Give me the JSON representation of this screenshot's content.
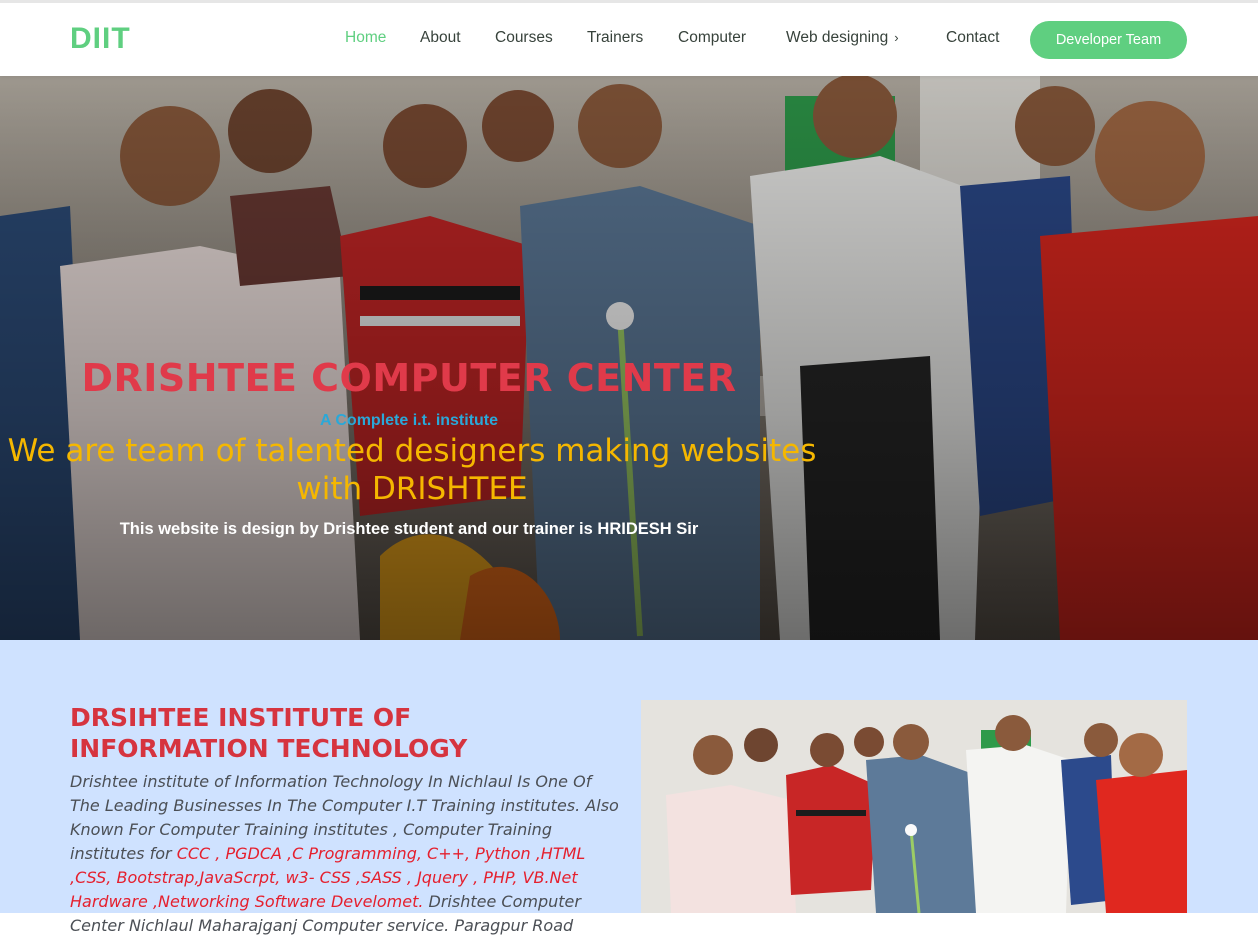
{
  "header": {
    "logo": "DIIT",
    "nav": [
      {
        "label": "Home",
        "active": true
      },
      {
        "label": "About"
      },
      {
        "label": "Courses"
      },
      {
        "label": "Trainers"
      },
      {
        "label": "Computer"
      },
      {
        "label": "Web designing",
        "has_submenu": true
      },
      {
        "label": "Contact"
      }
    ],
    "cta": "Developer Team"
  },
  "hero": {
    "title": "DRISHTEE COMPUTER CENTER",
    "subtitle": "A Complete i.t. institute",
    "tagline": "We are team of talented designers making websites with DRISHTEE",
    "credit": "This website is design by Drishtee student and our trainer is HRIDESH Sir"
  },
  "about": {
    "title": "DRSIHTEE INSTITUTE OF INFORMATION TECHNOLOGY",
    "text_plain": "Drishtee institute of Information Technology In Nichlaul Is One Of The Leading Businesses In The Computer I.T Training institutes. Also Known For Computer Training institutes , Computer Training institutes for ",
    "text_highlight": "CCC , PGDCA ,C Programming, C++, Python ,HTML ,CSS, Bootstrap,JavaScrpt, w3- CSS ,SASS , Jquery , PHP, VB.Net Hardware ,Networking Software Develomet.",
    "text_tail": " Drishtee Computer Center Nichlaul Maharajganj Computer service. Paragpur Road"
  },
  "colors": {
    "brand_green": "#5fcf80",
    "title_red": "#e03a4a",
    "subtitle_blue": "#2aa8d8",
    "tagline_gold": "#f5b700",
    "about_bg": "#cfe2ff"
  },
  "icons": {
    "submenu": "chevron-right-icon"
  }
}
